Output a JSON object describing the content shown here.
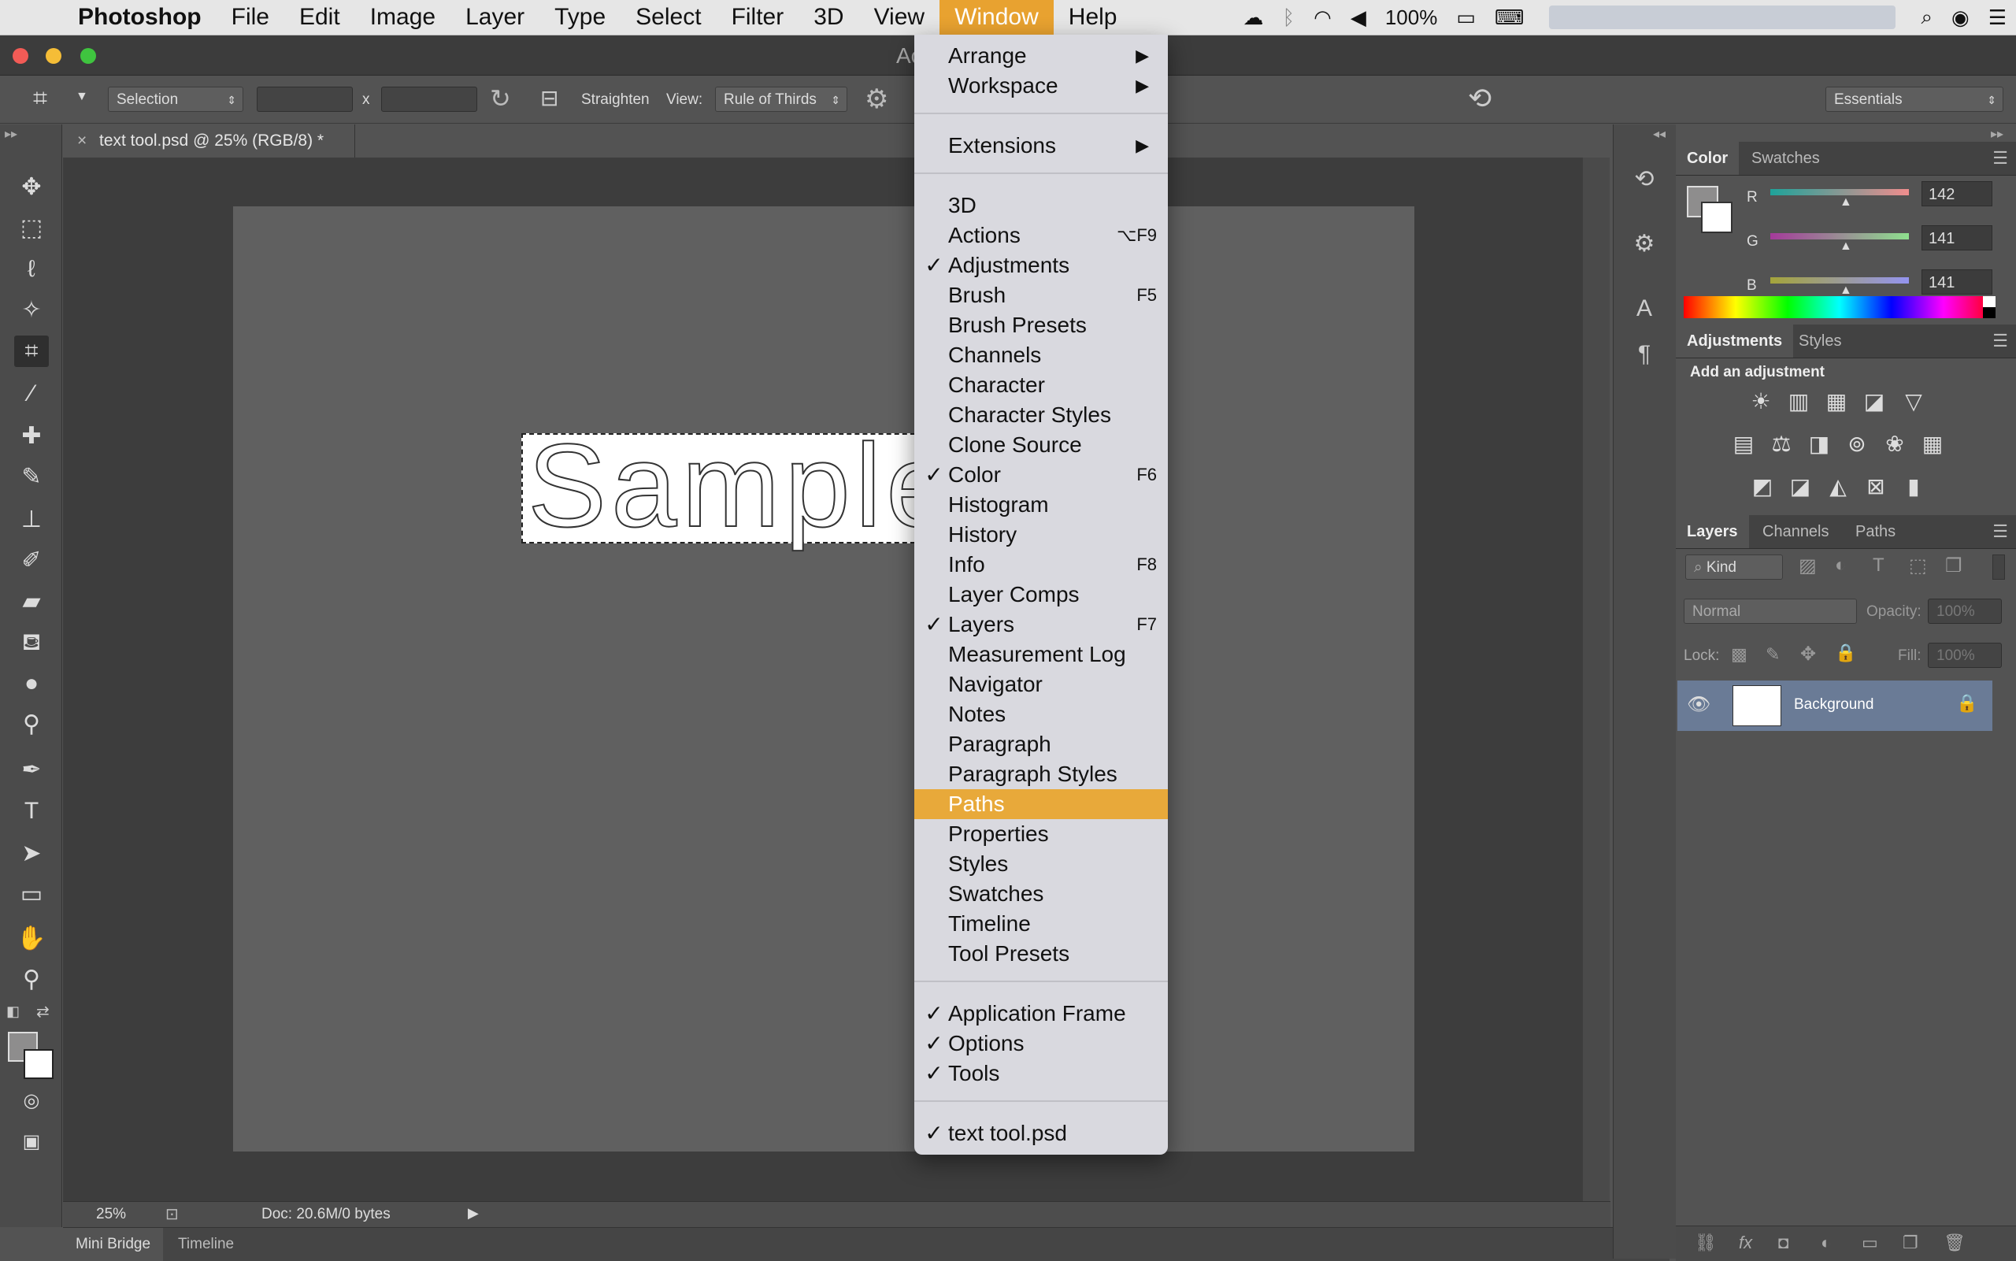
{
  "menubar": {
    "apple": "",
    "items": [
      {
        "label": "Photoshop",
        "app": true
      },
      {
        "label": "File"
      },
      {
        "label": "Edit"
      },
      {
        "label": "Image"
      },
      {
        "label": "Layer"
      },
      {
        "label": "Type"
      },
      {
        "label": "Select"
      },
      {
        "label": "Filter"
      },
      {
        "label": "3D"
      },
      {
        "label": "View"
      },
      {
        "label": "Window",
        "active": true
      },
      {
        "label": "Help"
      }
    ],
    "battery": "100%"
  },
  "window": {
    "title_partial": "Ac"
  },
  "options_bar": {
    "selection_label": "Selection",
    "x_label": "x",
    "straighten_label": "Straighten",
    "view_label": "View:",
    "view_value": "Rule of Thirds",
    "workspace_value": "Essentials"
  },
  "document": {
    "tab_title": "text tool.psd @ 25% (RGB/8) *",
    "sample_text": "Sample",
    "zoom": "25%",
    "doc_info": "Doc: 20.6M/0 bytes"
  },
  "bottom_tabs": [
    "Mini Bridge",
    "Timeline"
  ],
  "color_panel": {
    "tabs": [
      "Color",
      "Swatches"
    ],
    "channels": [
      {
        "label": "R",
        "value": "142"
      },
      {
        "label": "G",
        "value": "141"
      },
      {
        "label": "B",
        "value": "141"
      }
    ]
  },
  "adjustments_panel": {
    "tabs": [
      "Adjustments",
      "Styles"
    ],
    "heading": "Add an adjustment"
  },
  "layers_panel": {
    "tabs": [
      "Layers",
      "Channels",
      "Paths"
    ],
    "kind_label": "Kind",
    "blend_mode": "Normal",
    "opacity_label": "Opacity:",
    "opacity_value": "100%",
    "lock_label": "Lock:",
    "fill_label": "Fill:",
    "fill_value": "100%",
    "layer_name": "Background"
  },
  "window_menu": {
    "items": [
      {
        "label": "Arrange",
        "submenu": true
      },
      {
        "label": "Workspace",
        "submenu": true
      },
      {
        "sep": true
      },
      {
        "label": "Extensions",
        "submenu": true
      },
      {
        "sep": true
      },
      {
        "label": "3D"
      },
      {
        "label": "Actions",
        "shortcut": "⌥F9"
      },
      {
        "label": "Adjustments",
        "checked": true
      },
      {
        "label": "Brush",
        "shortcut": "F5"
      },
      {
        "label": "Brush Presets"
      },
      {
        "label": "Channels"
      },
      {
        "label": "Character"
      },
      {
        "label": "Character Styles"
      },
      {
        "label": "Clone Source"
      },
      {
        "label": "Color",
        "checked": true,
        "shortcut": "F6"
      },
      {
        "label": "Histogram"
      },
      {
        "label": "History"
      },
      {
        "label": "Info",
        "shortcut": "F8"
      },
      {
        "label": "Layer Comps"
      },
      {
        "label": "Layers",
        "checked": true,
        "shortcut": "F7"
      },
      {
        "label": "Measurement Log"
      },
      {
        "label": "Navigator"
      },
      {
        "label": "Notes"
      },
      {
        "label": "Paragraph"
      },
      {
        "label": "Paragraph Styles"
      },
      {
        "label": "Paths",
        "highlighted": true
      },
      {
        "label": "Properties"
      },
      {
        "label": "Styles"
      },
      {
        "label": "Swatches"
      },
      {
        "label": "Timeline"
      },
      {
        "label": "Tool Presets"
      },
      {
        "sep": true
      },
      {
        "label": "Application Frame",
        "checked": true
      },
      {
        "label": "Options",
        "checked": true
      },
      {
        "label": "Tools",
        "checked": true
      },
      {
        "sep": true
      },
      {
        "label": "text tool.psd",
        "checked": true
      }
    ],
    "check_glyph": "✓",
    "submenu_glyph": "▶"
  },
  "colors": {
    "accent": "#e8a93a",
    "menu_bg": "#d9d9df",
    "panel": "#535353"
  }
}
